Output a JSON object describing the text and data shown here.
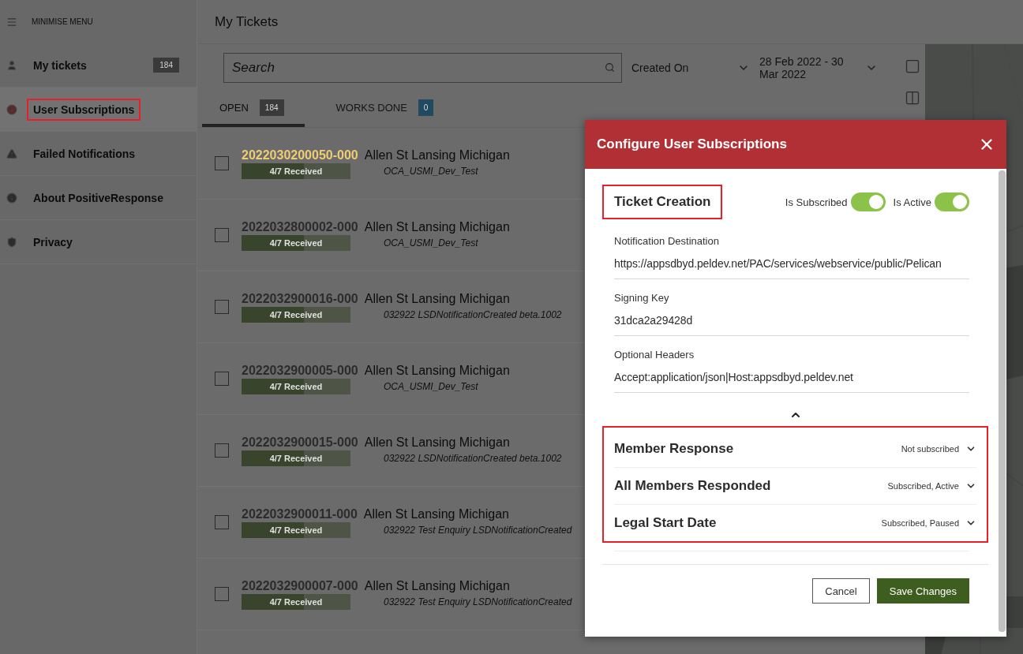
{
  "sidebar": {
    "menu_toggle": "MINIMISE MENU",
    "items": [
      {
        "label": "My tickets",
        "badge": "184",
        "selected": false
      },
      {
        "label": "User Subscriptions",
        "selected": true
      },
      {
        "label": "Failed Notifications",
        "selected": false
      },
      {
        "label": "About PositiveResponse",
        "selected": false
      },
      {
        "label": "Privacy",
        "selected": false
      }
    ]
  },
  "page": {
    "title": "My Tickets"
  },
  "toolbar": {
    "search": {
      "placeholder": "Search"
    },
    "sort": {
      "value": "Created On"
    },
    "date_range": {
      "value": "28 Feb 2022 - 30 Mar 2022"
    }
  },
  "tabs": [
    {
      "label": "OPEN",
      "count": "184",
      "color": "#3a3a3a",
      "selected": true
    },
    {
      "label": "WORKS DONE",
      "count": "0",
      "color": "#1f4a60",
      "selected": false
    }
  ],
  "tickets": [
    {
      "id": "2022030200050-000",
      "color": "#f0cd72",
      "address": "Allen St Lansing Michigan",
      "progress": {
        "label": "4/7 Received",
        "level": 0.57
      },
      "note": "OCA_USMI_Dev_Test",
      "checked": false
    },
    {
      "id": "2022032800002-000",
      "color": "#2c2c2c",
      "address": "Allen St Lansing Michigan",
      "progress": {
        "label": "4/7 Received",
        "level": 0.57
      },
      "note": "OCA_USMI_Dev_Test",
      "checked": false
    },
    {
      "id": "2022032900016-000",
      "color": "#2c2c2c",
      "address": "Allen St Lansing Michigan",
      "progress": {
        "label": "4/7 Received",
        "level": 0.57
      },
      "note": "032922 LSDNotificationCreated beta.1002",
      "checked": false
    },
    {
      "id": "2022032900005-000",
      "color": "#2c2c2c",
      "address": "Allen St Lansing Michigan",
      "progress": {
        "label": "4/7 Received",
        "level": 0.57
      },
      "note": "OCA_USMI_Dev_Test",
      "checked": false
    },
    {
      "id": "2022032900015-000",
      "color": "#2c2c2c",
      "address": "Allen St Lansing Michigan",
      "progress": {
        "label": "4/7 Received",
        "level": 0.57
      },
      "note": "032922 LSDNotificationCreated beta.1002",
      "checked": false
    },
    {
      "id": "2022032900011-000",
      "color": "#2c2c2c",
      "address": "Allen St Lansing Michigan",
      "progress": {
        "label": "4/7 Received",
        "level": 0.57
      },
      "note": "032922 Test Enquiry LSDNotificationCreated",
      "checked": false
    },
    {
      "id": "2022032900007-000",
      "color": "#2c2c2c",
      "address": "Allen St Lansing Michigan",
      "progress": {
        "label": "4/7 Received",
        "level": 0.57
      },
      "note": "032922 Test Enquiry LSDNotificationCreated",
      "checked": false
    }
  ],
  "dialog": {
    "title": "Configure User Subscriptions",
    "sections": [
      {
        "title": "Ticket Creation",
        "expanded": true,
        "toggles": [
          {
            "label": "Is Subscribed",
            "on": true
          },
          {
            "label": "Is Active",
            "on": true
          }
        ],
        "fields": [
          {
            "label": "Notification Destination",
            "value": "https://appsdbyd.peldev.net/PAC/services/webservice/public/Pelican"
          },
          {
            "label": "Signing Key",
            "value": "31dca2a29428d"
          },
          {
            "label": "Optional Headers",
            "value": "Accept:application/json|Host:appsdbyd.peldev.net"
          }
        ]
      },
      {
        "title": "Member Response",
        "expanded": false,
        "status": "Not subscribed"
      },
      {
        "title": "All Members Responded",
        "expanded": false,
        "status": "Subscribed, Active"
      },
      {
        "title": "Legal Start Date",
        "expanded": false,
        "status": "Subscribed, Paused"
      }
    ],
    "buttons": [
      {
        "label": "Cancel",
        "kind": "secondary"
      },
      {
        "label": "Save Changes",
        "kind": "primary"
      }
    ]
  }
}
